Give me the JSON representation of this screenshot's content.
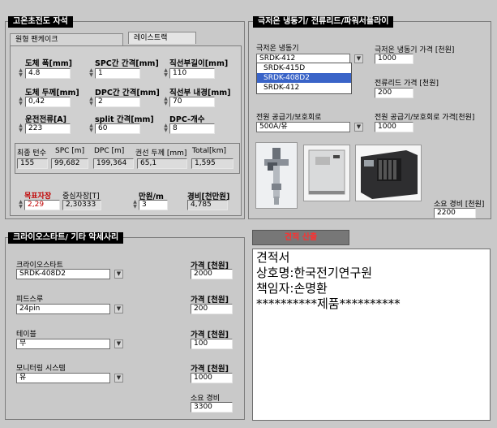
{
  "superconductor": {
    "title": "고온초전도 자석",
    "tabs": [
      "원형 팬케이크",
      "레이스트랙"
    ],
    "width_label": "도체 폭[mm]",
    "width": "4.8",
    "spc_gap_label": "SPC간 간격[mm]",
    "spc_gap": "1",
    "straight_len_label": "직선부길이[mm]",
    "straight_len": "110",
    "thickness_label": "도체 두께[mm]",
    "thickness": "0,42",
    "dpc_gap_label": "DPC간 간격[mm]",
    "dpc_gap": "2",
    "inner_dia_label": "직선부 내경[mm]",
    "inner_dia": "70",
    "current_label": "운전전류[A]",
    "current": "223",
    "split_label": "split 간격[mm]",
    "split": "60",
    "dpc_count_label": "DPC-개수",
    "dpc_count": "8",
    "results": {
      "labels": [
        "최종 턴수",
        "SPC [m]",
        "DPC [m]",
        "권선 두께 [mm]",
        "Total[km]"
      ],
      "values": [
        "155",
        "99,682",
        "199,364",
        "65,1",
        "1,595"
      ]
    },
    "target_field_label": "목표자장",
    "target_field": "2,29",
    "center_field_label": "중심자장[T]",
    "center_field": "2,30333",
    "price_per_m_label": "만원/m",
    "price_per_m": "3",
    "cost_label": "경비[천만원]",
    "cost": "4,785"
  },
  "cryocooler": {
    "title": "극저온 냉동기/ 전류리드/파워서플라이",
    "cooler_label": "극저온 냉동기",
    "cooler_value": "SRDK-412",
    "cooler_options": [
      "SRDK-415D",
      "SRDK-408D2",
      "SRDK-412"
    ],
    "cooler_selected": "SRDK-408D2",
    "cooler_price_label": "극저온 냉동기 가격 [천원]",
    "cooler_price": "1000",
    "lead_price_label": "전류리드 가격 [천원]",
    "lead_price": "200",
    "psu_label": "전원 공급기/보호회로",
    "psu_value": "500A/유",
    "psu_price_label": "전원 공급기/보호회로 가격[천원]",
    "psu_price": "1000",
    "total_label": "소요 경비 [천원]",
    "total": "2200"
  },
  "accessories": {
    "title": "크라이오스타트/ 기타 악세사리",
    "price_label": "가격 [천원]",
    "items": [
      {
        "label": "크라이오스타트",
        "value": "SRDK-408D2",
        "price": "2000"
      },
      {
        "label": "피드스루",
        "value": "24pin",
        "price": "200"
      },
      {
        "label": "테이블",
        "value": "무",
        "price": "100"
      },
      {
        "label": "모니터링 시스템",
        "value": "유",
        "price": "1000"
      }
    ],
    "total_label": "소요 경비",
    "total": "3300"
  },
  "quote": {
    "button": "견적 산출",
    "lines": [
      "견적서",
      "상호명:한국전기연구원",
      "책임자:손명환",
      "**********제품**********"
    ]
  }
}
